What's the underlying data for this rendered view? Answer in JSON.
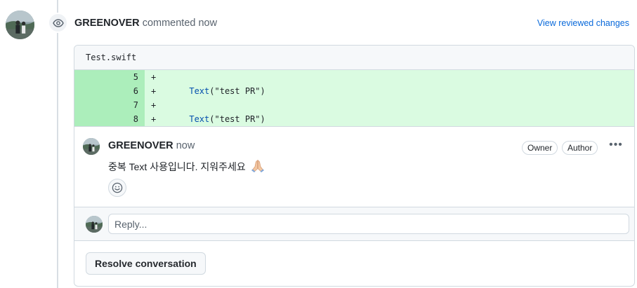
{
  "review": {
    "author": "GREENOVER",
    "action": "commented now",
    "view_changes_label": "View reviewed changes"
  },
  "file": {
    "name": "Test.swift"
  },
  "diff": {
    "lines": [
      {
        "num": "5",
        "sign": "+",
        "indent": "",
        "fn": "",
        "rest": ""
      },
      {
        "num": "6",
        "sign": "+",
        "indent": "      ",
        "fn": "Text",
        "rest": "(\"test PR\")"
      },
      {
        "num": "7",
        "sign": "+",
        "indent": "",
        "fn": "",
        "rest": ""
      },
      {
        "num": "8",
        "sign": "+",
        "indent": "      ",
        "fn": "Text",
        "rest": "(\"test PR\")"
      }
    ]
  },
  "comment": {
    "author": "GREENOVER",
    "time": "now",
    "badges": [
      "Owner",
      "Author"
    ],
    "body": "중복 Text 사용입니다. 지워주세요",
    "more_label": "•••"
  },
  "reply": {
    "placeholder": "Reply..."
  },
  "resolve": {
    "label": "Resolve conversation"
  },
  "colors": {
    "link": "#0969da",
    "added_line_bg": "#dafbe1",
    "added_num_bg": "#aceebb",
    "border": "#d1d9e0"
  },
  "icons": [
    "avatar",
    "eye-icon",
    "praying-hands-emoji",
    "smiley-icon",
    "kebab-icon"
  ]
}
